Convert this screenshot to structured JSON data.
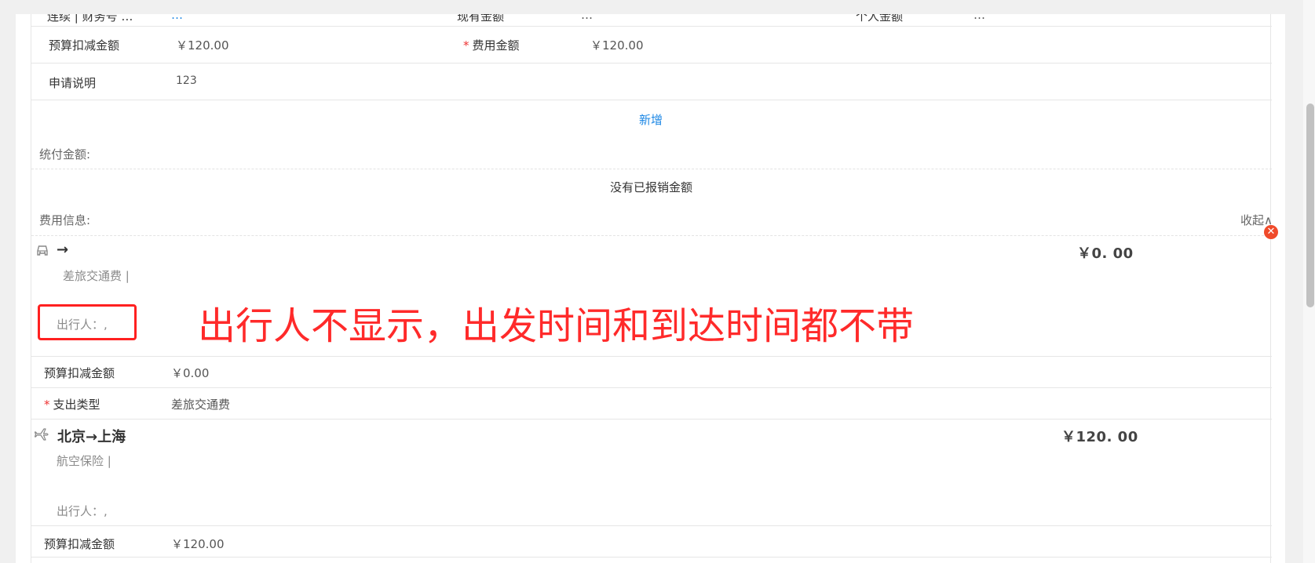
{
  "top_partial": {
    "label1": "连续 | 财务号 …",
    "val1": "…",
    "label2": "现有金额",
    "val2": "…",
    "label3": "个人金额",
    "val3": "…"
  },
  "budget_row": {
    "label": "预算扣减金额",
    "value": "￥120.00",
    "fee_label": "费用金额",
    "fee_value": "￥120.00"
  },
  "desc_row": {
    "label": "申请说明",
    "value": "123"
  },
  "add_link": "新增",
  "pay_label": "统付金额:",
  "no_reimbursed": "没有已报销金额",
  "fee_info_label": "费用信息:",
  "collapse_label": "收起∧",
  "close_icon": "close-icon",
  "item1": {
    "icon": "car-icon",
    "route": "→",
    "amount": "￥0. 00",
    "category": "差旅交通费 |",
    "traveler": "出行人：,",
    "budget_label": "预算扣减金额",
    "budget_value": "￥0.00",
    "type_label": "支出类型",
    "type_value": "差旅交通费"
  },
  "item2": {
    "icon": "plane-icon",
    "route": "北京→上海",
    "amount": "￥120. 00",
    "category": "航空保险 |",
    "traveler": "出行人：,",
    "budget_label": "预算扣减金额",
    "budget_value": "￥120.00"
  },
  "annotation": {
    "text": "出行人不显示，出发时间和到达时间都不带"
  },
  "colors": {
    "accent": "#1e88e5",
    "required": "#e33333",
    "annotation": "#ff2a2a",
    "badge": "#f04a2a"
  }
}
